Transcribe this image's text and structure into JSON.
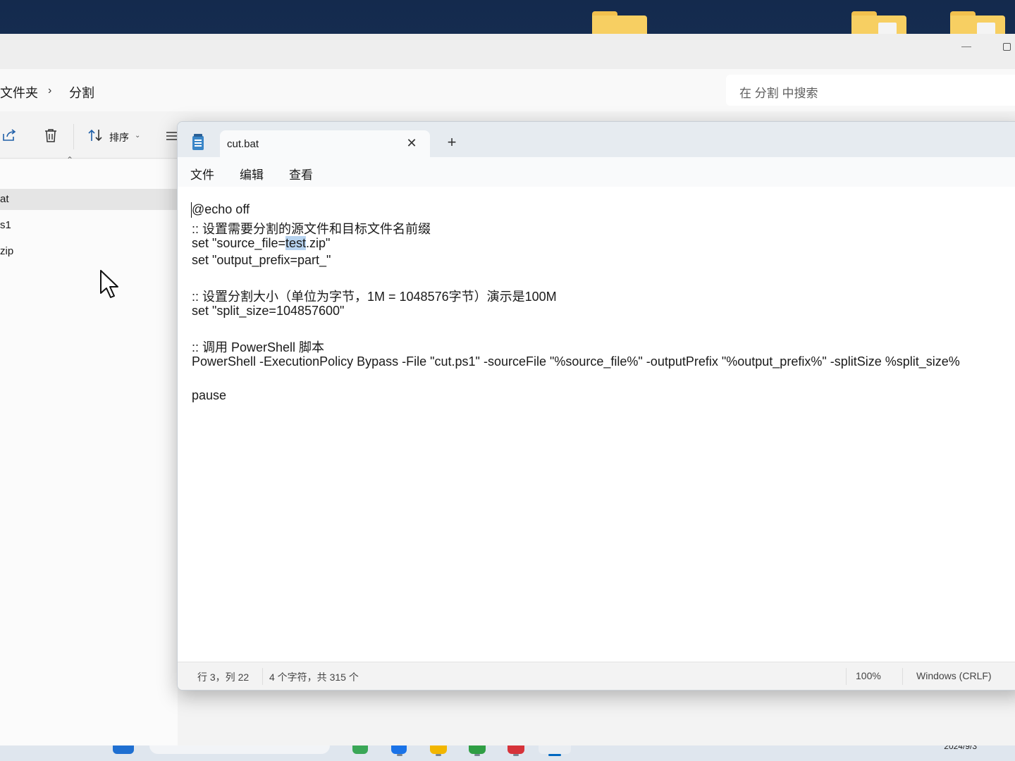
{
  "explorer": {
    "breadcrumb": [
      "文件夹",
      "分割"
    ],
    "breadcrumb_separator": "›",
    "search_placeholder": "在 分割 中搜索",
    "toolbar": {
      "sort_label": "排序"
    },
    "files": [
      "at",
      "s1",
      "zip"
    ],
    "selected_index": 0
  },
  "notepad": {
    "tab_title": "cut.bat",
    "menu": [
      "文件",
      "编辑",
      "查看"
    ],
    "lines": [
      "@echo off",
      ":: 设置需要分割的源文件和目标文件名前缀",
      "set \"source_file=test.zip\"",
      "set \"output_prefix=part_\"",
      "",
      ":: 设置分割大小（单位为字节，1M = 1048576字节）演示是100M",
      "set \"split_size=104857600\"",
      "",
      ":: 调用 PowerShell 脚本",
      "PowerShell -ExecutionPolicy Bypass -File \"cut.ps1\" -sourceFile \"%source_file%\" -outputPrefix \"%output_prefix%\" -splitSize %split_size%",
      "",
      "pause"
    ],
    "selection": {
      "line_index": 2,
      "before": "set \"source_file=",
      "selected": "test",
      "after": ".zip\""
    },
    "status": {
      "position": "行 3，列 22",
      "selection_info": "4 个字符，共 315 个",
      "zoom": "100%",
      "line_ending": "Windows (CRLF)"
    }
  },
  "taskbar": {
    "date": "2024/9/3"
  },
  "colors": {
    "selection": "#b8d4f0",
    "accent": "#0067c0"
  }
}
